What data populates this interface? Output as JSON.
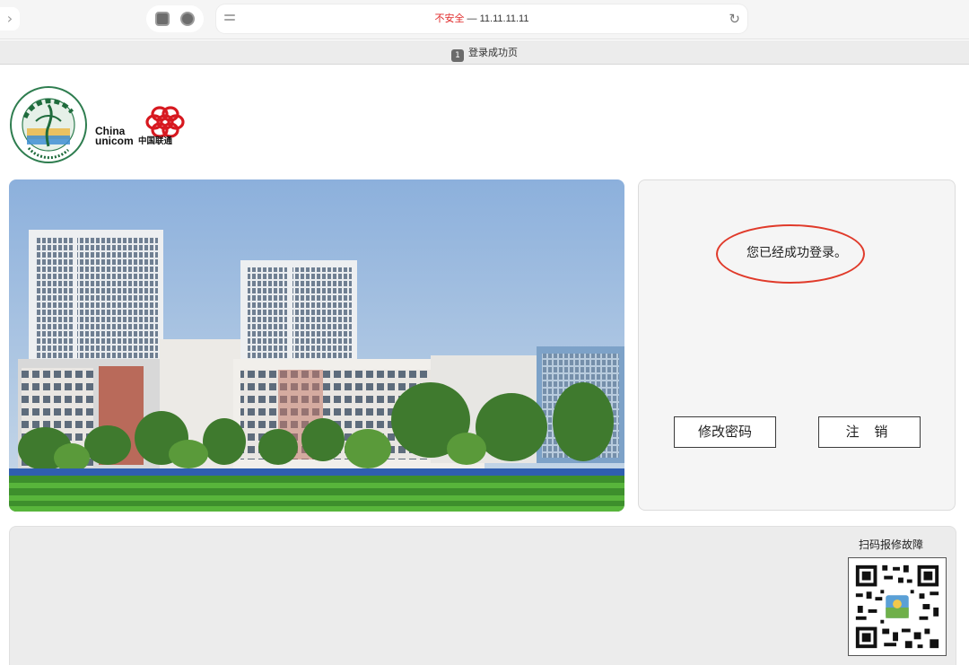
{
  "browser": {
    "forward_icon": "chevron-right-icon",
    "address_warning": "不安全",
    "address_separator": " — ",
    "address_url": "11.11.11.11"
  },
  "tab": {
    "badge": "1",
    "title": "登录成功页"
  },
  "logos": {
    "unicom_en_line1": "China",
    "unicom_en_line2": "unicom",
    "unicom_cn": "中国联通",
    "school_emblem_text": "Guangdong Nanfang Vocational College"
  },
  "panel": {
    "message": "您已经成功登录。",
    "change_password_label": "修改密码",
    "logout_label": "注 销"
  },
  "footer": {
    "repair_label": "扫码报修故障"
  },
  "colors": {
    "warning": "#e02a2a",
    "annotation_circle": "#e03a2a",
    "unicom_red": "#d71920"
  }
}
